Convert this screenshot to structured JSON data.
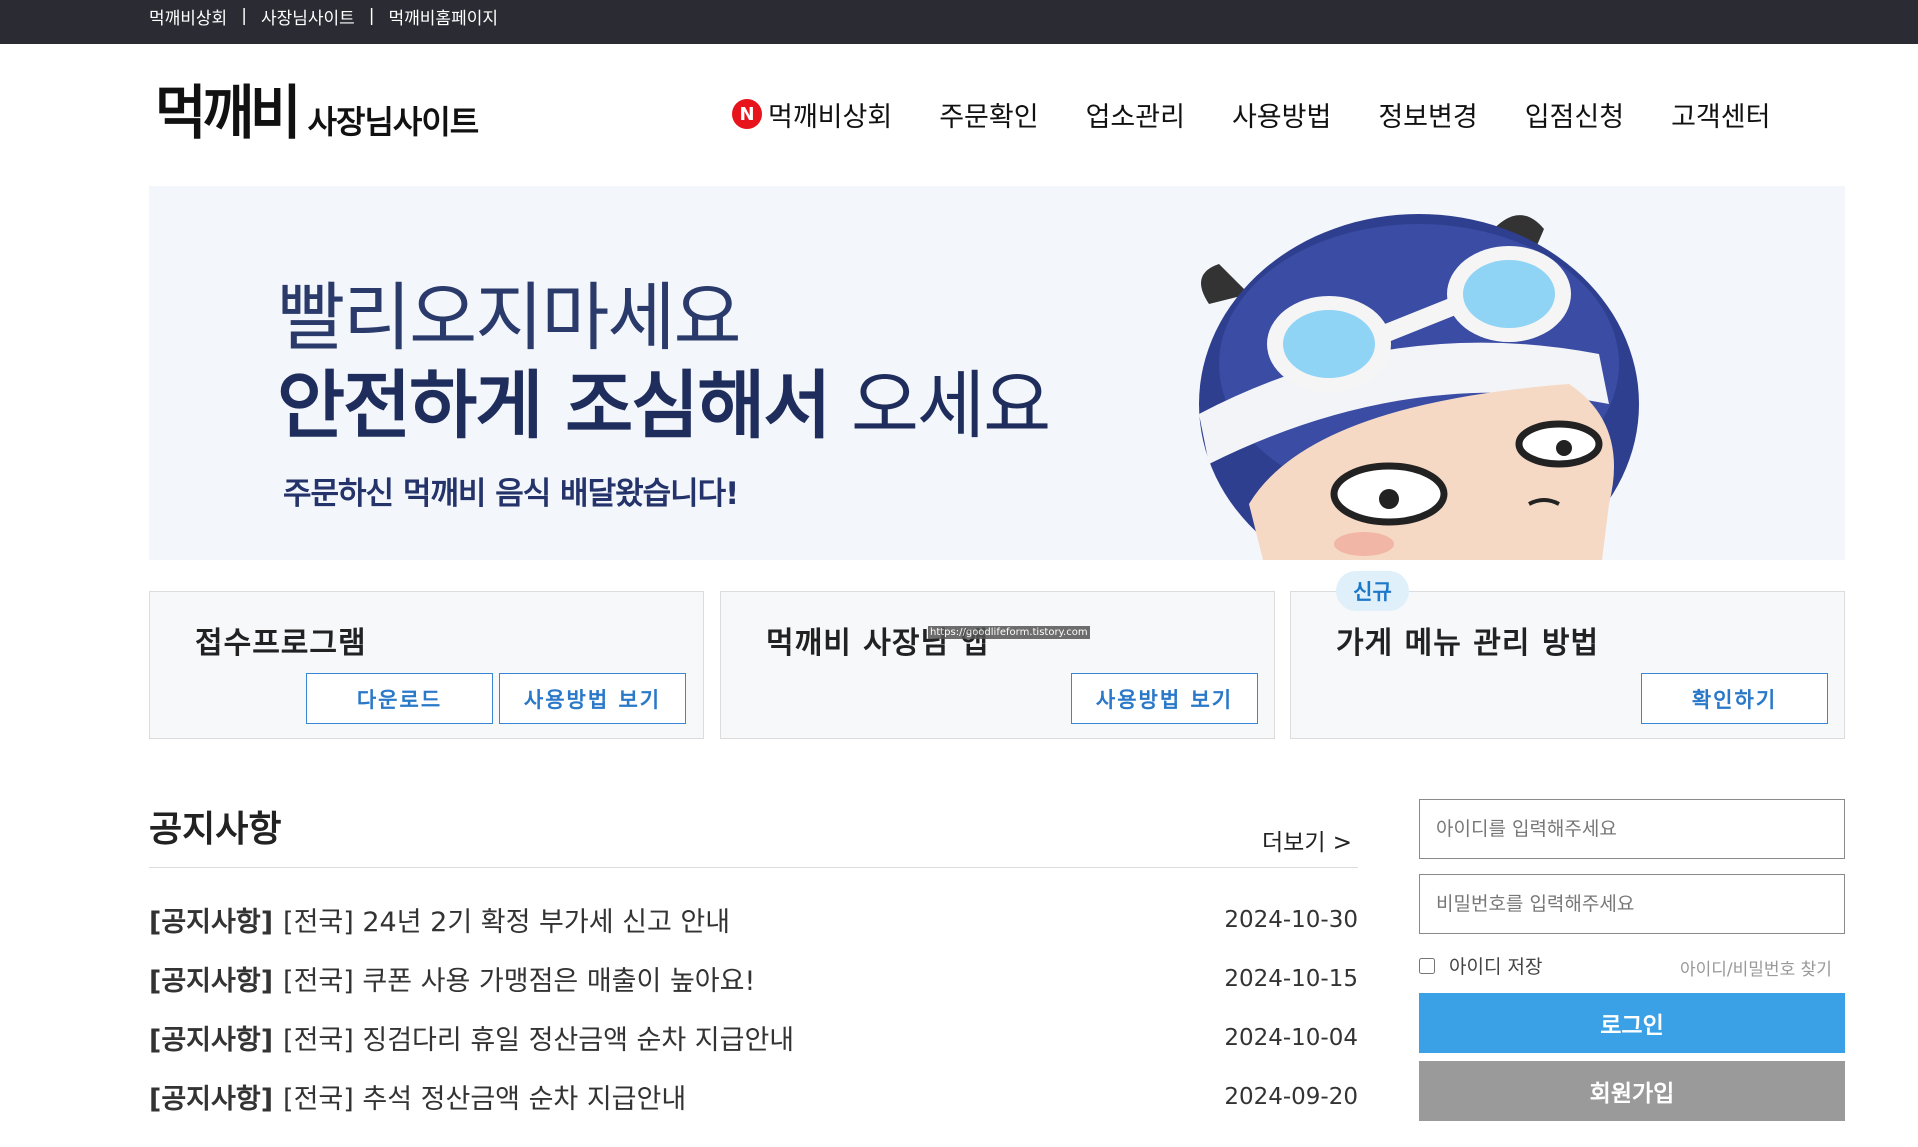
{
  "topbar": {
    "links": [
      "먹깨비상회",
      "사장님사이트",
      "먹깨비홈페이지"
    ],
    "separator": "|"
  },
  "header": {
    "logo_main": "먹깨비",
    "logo_sub": "사장님사이트",
    "nav": [
      {
        "label": "먹깨비상회",
        "badge": "N"
      },
      {
        "label": "주문확인"
      },
      {
        "label": "업소관리"
      },
      {
        "label": "사용방법"
      },
      {
        "label": "정보변경"
      },
      {
        "label": "입점신청"
      },
      {
        "label": "고객센터"
      }
    ]
  },
  "banner": {
    "line1": "빨리오지마세요",
    "line2_bold": "안전하게 조심해서",
    "line2_normal": " 오세요",
    "line3": "주문하신 먹깨비 음식 배달왔습니다!",
    "mascot_icon": "mascot-helmet-character"
  },
  "cards": [
    {
      "title": "접수프로그램",
      "buttons": [
        "다운로드",
        "사용방법 보기"
      ]
    },
    {
      "title": "먹깨비 사장님 앱",
      "buttons": [
        "사용방법 보기"
      ],
      "overlay_text": "https://goodlifeform.tistory.com"
    },
    {
      "title": "가게 메뉴 관리 방법",
      "buttons": [
        "확인하기"
      ],
      "badge": "신규"
    }
  ],
  "notices": {
    "title": "공지사항",
    "more": "더보기 >",
    "items": [
      {
        "category": "[공지사항]",
        "text": "[전국] 24년 2기 확정 부가세 신고 안내",
        "date": "2024-10-30"
      },
      {
        "category": "[공지사항]",
        "text": "[전국] 쿠폰 사용 가맹점은 매출이 높아요!",
        "date": "2024-10-15"
      },
      {
        "category": "[공지사항]",
        "text": "[전국] 징검다리 휴일 정산금액 순차 지급안내",
        "date": "2024-10-04"
      },
      {
        "category": "[공지사항]",
        "text": "[전국] 추석 정산금액 순차 지급안내",
        "date": "2024-09-20"
      }
    ]
  },
  "login": {
    "id_placeholder": "아이디를 입력해주세요",
    "pw_placeholder": "비밀번호를 입력해주세요",
    "save_id_label": "아이디 저장",
    "find_link": "아이디/비밀번호 찾기",
    "login_button": "로그인",
    "join_button": "회원가입"
  },
  "colors": {
    "topbar_bg": "#2b2c33",
    "accent_blue": "#3ba1e6",
    "button_border_blue": "#3a86d6",
    "badge_red": "#e8141b",
    "banner_navy": "#1e2d5c",
    "join_gray": "#9a9a9a"
  }
}
